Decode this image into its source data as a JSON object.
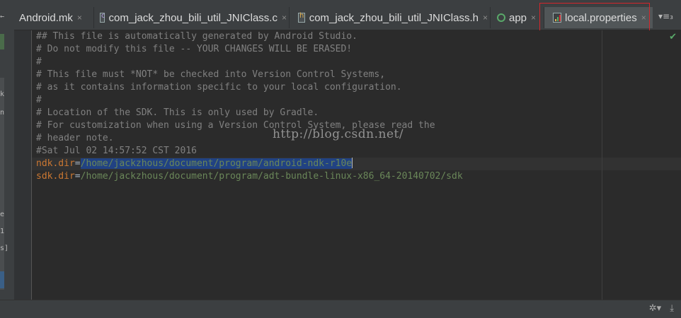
{
  "tabs": [
    {
      "label": "Android.mk",
      "icon": "mk-file-icon",
      "active": false
    },
    {
      "label": "com_jack_zhou_bili_util_JNIClass.c",
      "icon": "c-file-icon",
      "active": false
    },
    {
      "label": "com_jack_zhou_bili_util_JNIClass.h",
      "icon": "h-file-icon",
      "active": false
    },
    {
      "label": "app",
      "icon": "gradle-icon",
      "active": false
    },
    {
      "label": "local.properties",
      "icon": "properties-file-icon",
      "active": true
    }
  ],
  "tab_close_glyph": "×",
  "tab_list_menu": "▾≡₃",
  "editor": {
    "lines": [
      "## This file is automatically generated by Android Studio.",
      "# Do not modify this file -- YOUR CHANGES WILL BE ERASED!",
      "#",
      "# This file must *NOT* be checked into Version Control Systems,",
      "# as it contains information specific to your local configuration.",
      "#",
      "# Location of the SDK. This is only used by Gradle.",
      "# For customization when using a Version Control System, please read the",
      "# header note.",
      "#Sat Jul 02 14:57:52 CST 2016"
    ],
    "ndk": {
      "key": "ndk.dir",
      "eq": "=",
      "value": "/home/jackzhous/document/program/android-ndk-r10e"
    },
    "sdk": {
      "key": "sdk.dir",
      "eq": "=",
      "value": "/home/jackzhous/document/program/adt-bundle-linux-x86_64-20140702/sdk"
    },
    "check_glyph": "✔"
  },
  "watermark": "http://blog.csdn.net/",
  "status": {
    "settings_glyph": "✲▾",
    "download_glyph": "⤓"
  },
  "left_strip_glyphs": [
    "←",
    "ı",
    "k",
    "n",
    "e",
    "1",
    "s]"
  ],
  "colors": {
    "highlight": "#d4262b",
    "comment": "#808080",
    "key": "#cc7832",
    "value": "#6a8759",
    "selection": "#214283"
  }
}
